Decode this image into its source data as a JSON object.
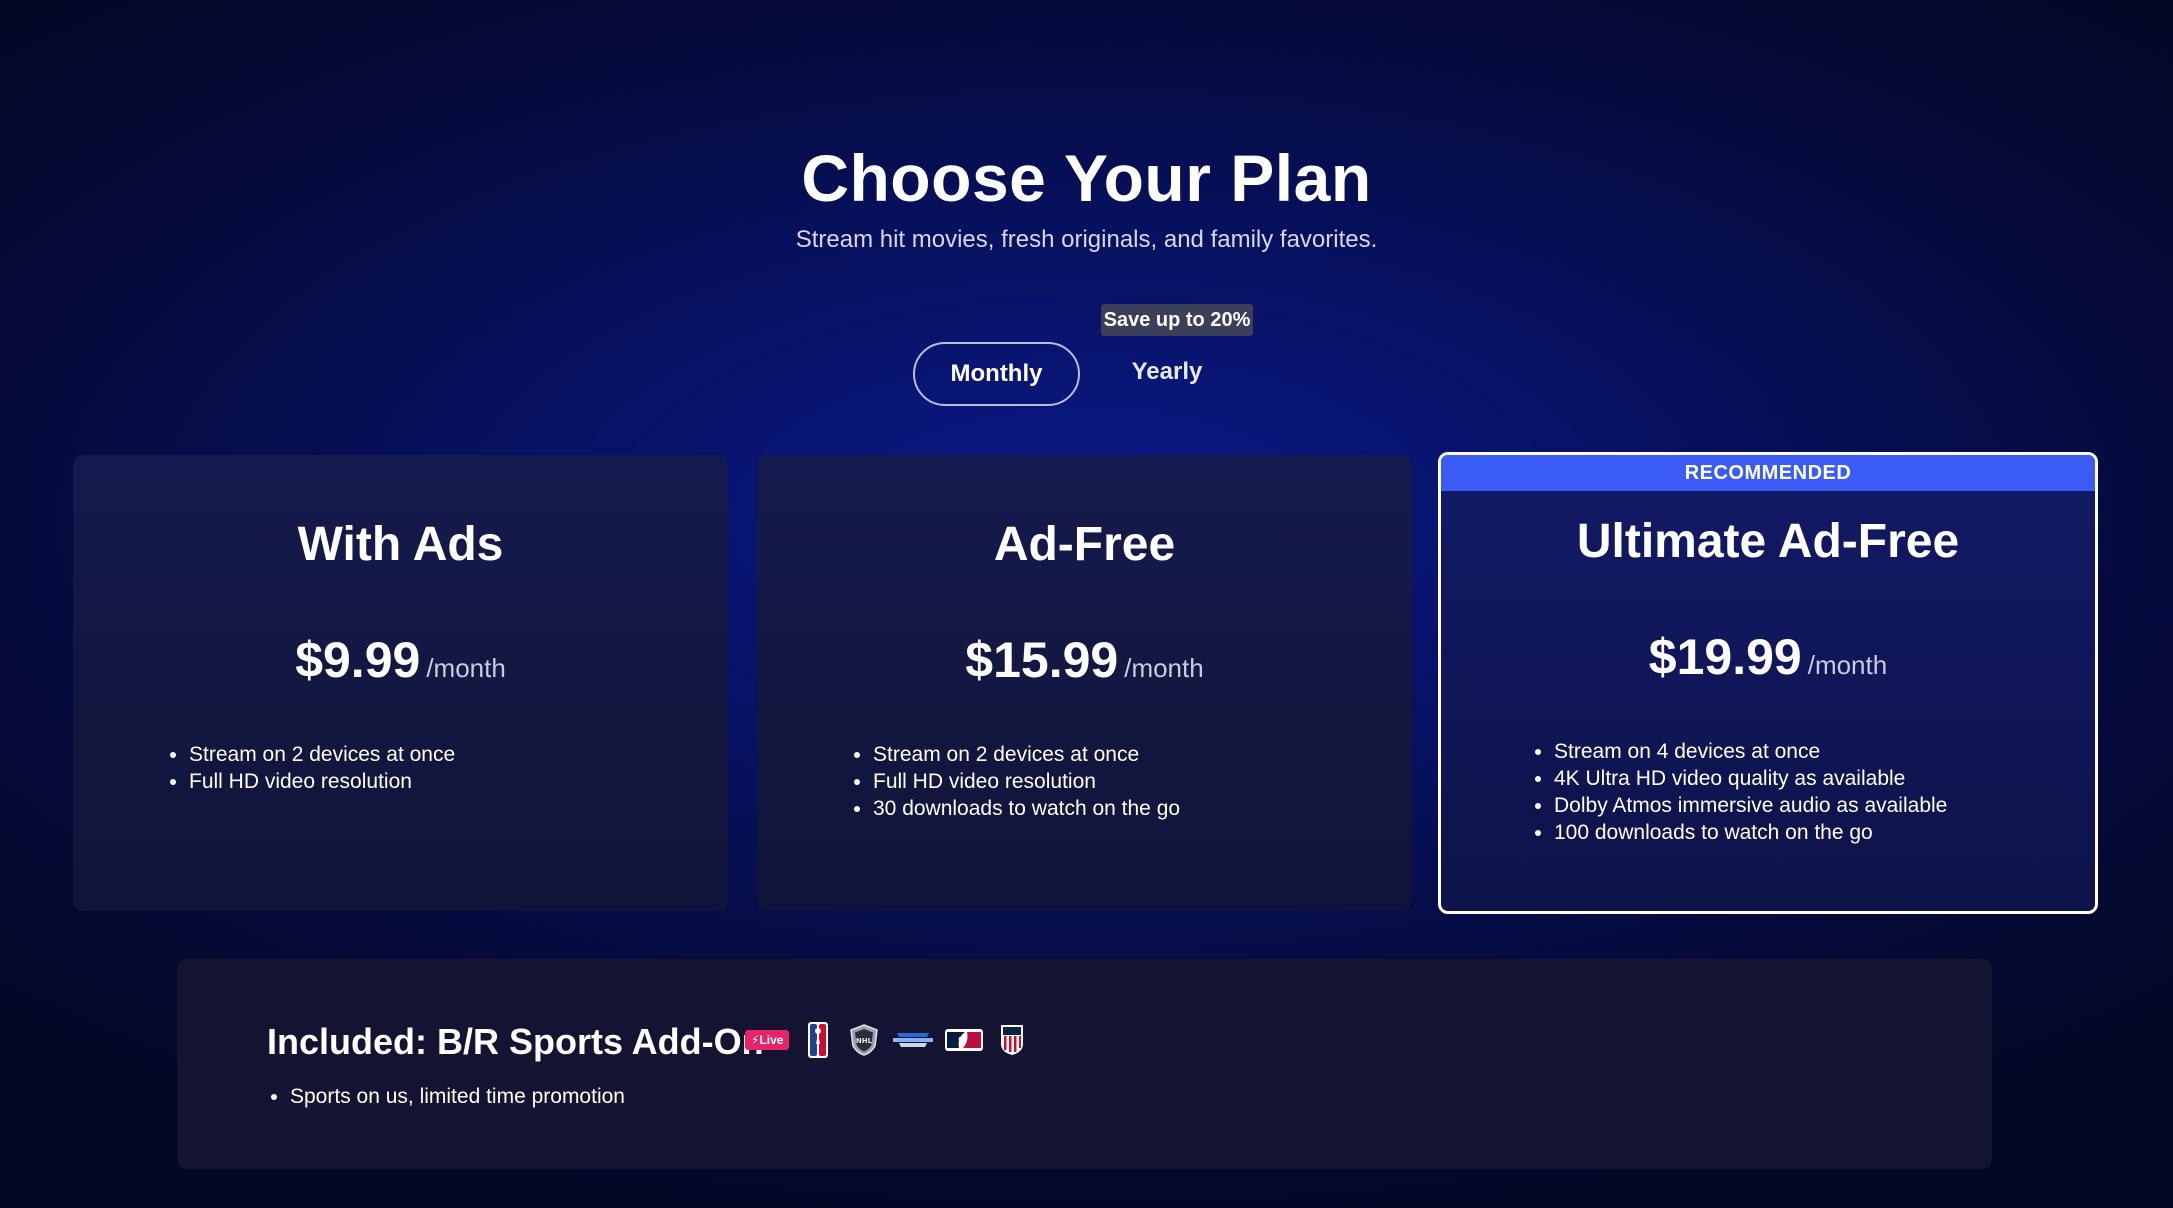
{
  "header": {
    "title": "Choose Your Plan",
    "subtitle": "Stream hit movies, fresh originals, and family favorites."
  },
  "billing": {
    "save_badge": "Save up to 20%",
    "options": [
      "Monthly",
      "Yearly"
    ],
    "selected": "Monthly"
  },
  "plans": [
    {
      "name": "With Ads",
      "price": "$9.99",
      "period": "/month",
      "features": [
        "Stream on 2 devices at once",
        "Full HD video resolution"
      ]
    },
    {
      "name": "Ad-Free",
      "price": "$15.99",
      "period": "/month",
      "features": [
        "Stream on 2 devices at once",
        "Full HD video resolution",
        "30 downloads to watch on the go"
      ]
    },
    {
      "name": "Ultimate Ad-Free",
      "badge": "RECOMMENDED",
      "price": "$19.99",
      "period": "/month",
      "features": [
        "Stream on 4 devices at once",
        "4K Ultra HD video quality as available",
        "Dolby Atmos immersive audio as available",
        "100 downloads to watch on the go"
      ]
    }
  ],
  "addon": {
    "title": "Included: B/R Sports Add-On",
    "live_label": "Live",
    "logos": [
      "live-badge-icon",
      "nba-logo-icon",
      "nhl-logo-icon",
      "march-madness-logo-icon",
      "mlb-logo-icon",
      "us-soccer-logo-icon"
    ],
    "features": [
      "Sports on us, limited time promotion"
    ]
  },
  "colors": {
    "accent": "#3a5cf5",
    "live": "#e6246a",
    "background": "#071160"
  }
}
